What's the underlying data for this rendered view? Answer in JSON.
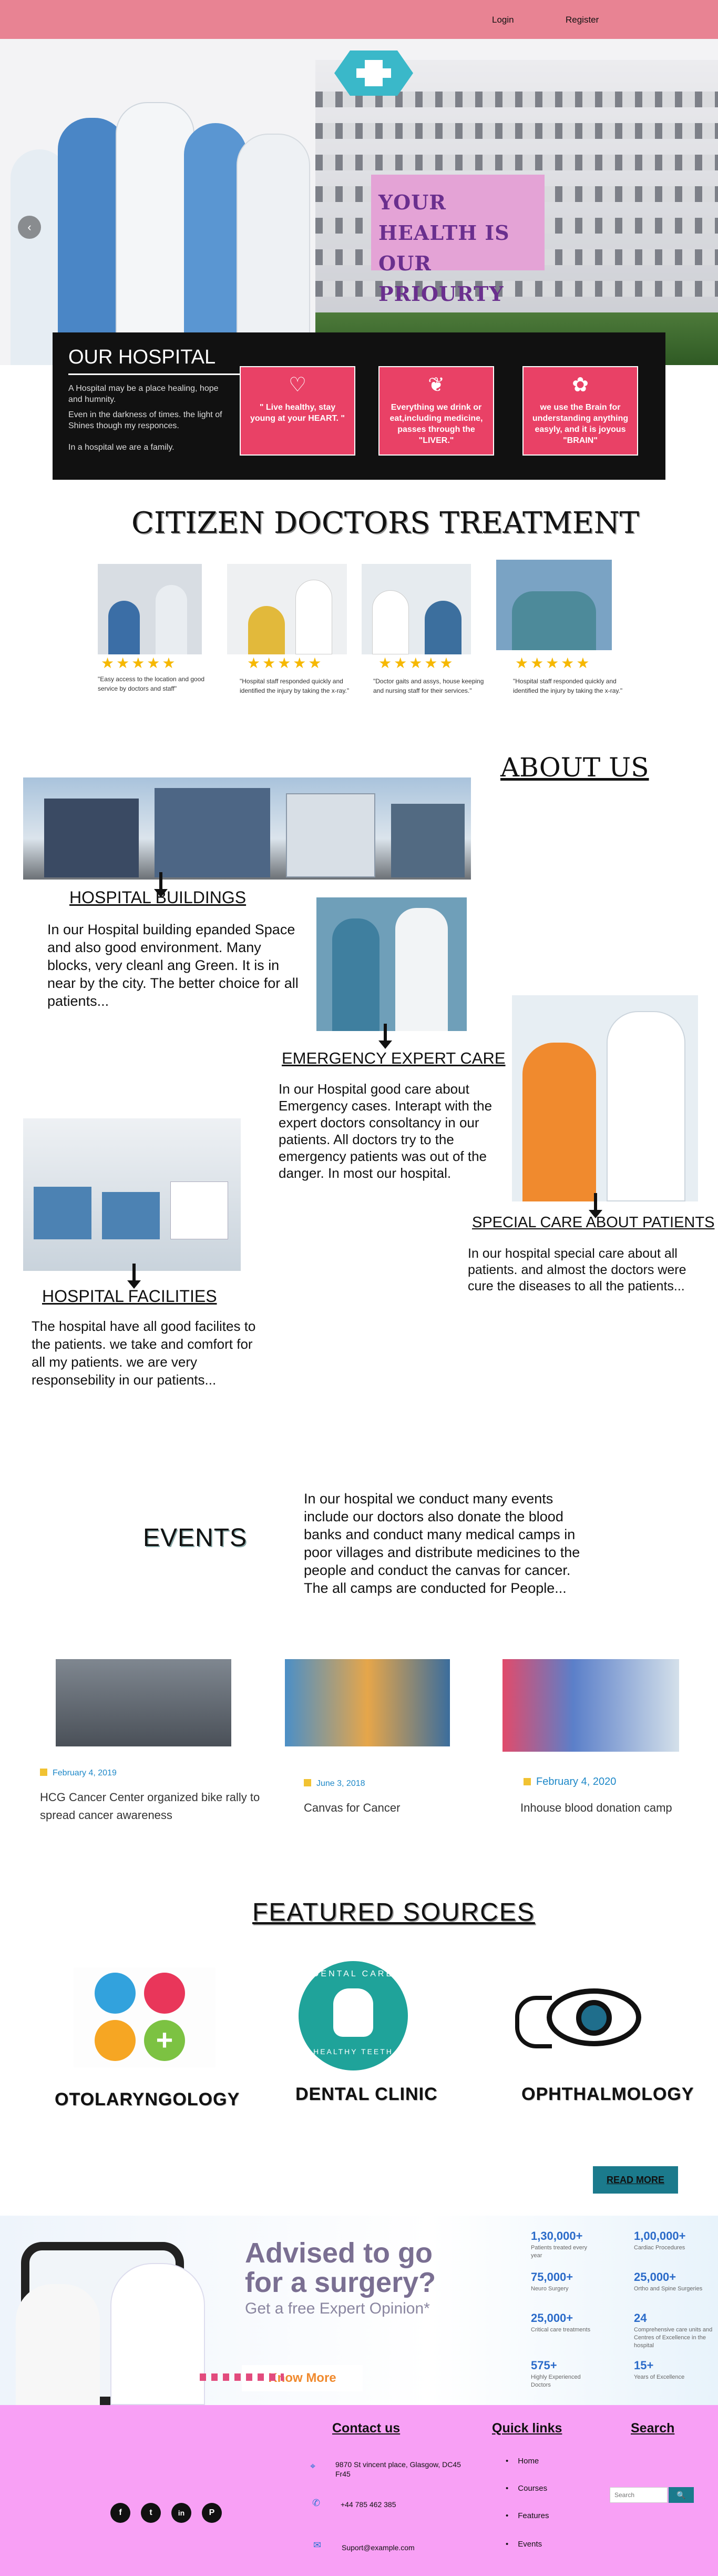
{
  "header": {
    "login": "Login",
    "register": "Register"
  },
  "hero": {
    "slogan_line1": "YOUR HEALTH IS",
    "slogan_line2": "OUR PRIOURTY",
    "prev_arrow": "‹"
  },
  "hospital_panel": {
    "title": "OUR HOSPITAL",
    "intro": "A Hospital may be a place healing, hope and humnity.",
    "line2": "Even in the darkness of times. the light of Shines though my responces.",
    "line3": "In a hospital we are a family.",
    "boxes": [
      {
        "text": "\" Live healthy, stay young at your HEART. \"",
        "icon": "heart-pulse-icon"
      },
      {
        "text": "Everything we drink or eat,including medicine, passes through the \"LIVER.\"",
        "icon": "liver-icon"
      },
      {
        "text": "we use the Brain for understanding anything easyly, and it is joyous \"BRAIN\"",
        "icon": "brain-icon"
      }
    ]
  },
  "treatment": {
    "title": "CITIZEN DOCTORS TREATMENT",
    "cards": [
      {
        "stars": "★★★★★",
        "caption": "\"Easy access to the location and good service by doctors and staff\""
      },
      {
        "stars": "★★★★★",
        "caption": "\"Hospital staff responded quickly and identified the injury by taking the x-ray.\""
      },
      {
        "stars": "★★★★★",
        "caption": "\"Doctor gaits and assys, house keeping and nursing staff for their services.\""
      },
      {
        "stars": "★★★★★",
        "caption": "\"Hospital staff responded quickly and identified the injury by taking the x-ray.\""
      }
    ]
  },
  "about": {
    "title": "ABOUT US",
    "buildings": {
      "heading": "HOSPITAL BUILDINGS",
      "text": "In our Hospital building epanded Space and also good environment. Many blocks, very cleanl ang Green. It is in near by the city. The better choice for all patients..."
    },
    "emergency": {
      "heading": "EMERGENCY EXPERT CARE",
      "text": "In our Hospital good care about Emergency cases. Interapt with the expert doctors consoltancy in our patients. All doctors try to the emergency patients was out of the danger. In most our hospital."
    },
    "special": {
      "heading": "SPECIAL CARE ABOUT PATIENTS",
      "text": "In our hospital special care about all patients. and almost the doctors were cure the diseases to all the patients..."
    },
    "facilities": {
      "heading": "HOSPITAL FACILITIES",
      "text": "The hospital have all good facilites to the patients. we take and comfort for all my patients. we are very responsebility in our patients..."
    }
  },
  "events": {
    "title": "EVENTS",
    "intro": "In our hospital we conduct many events include our doctors also donate the blood banks and conduct many medical camps in poor villages and distribute medicines to the people and conduct the canvas for cancer. The all camps are conducted for People...",
    "items": [
      {
        "date": "February 4, 2019",
        "title": "HCG Cancer Center organized bike rally to spread cancer awareness"
      },
      {
        "date": "June 3, 2018",
        "title": "Canvas for Cancer"
      },
      {
        "date": "February 4, 2020",
        "title": "Inhouse blood donation camp"
      }
    ]
  },
  "featured": {
    "title": "FEATURED SOURCES",
    "items": [
      {
        "label": "OTOLARYNGOLOGY",
        "icon": "ent-organs-icon"
      },
      {
        "label": "DENTAL CLINIC",
        "icon": "tooth-icon",
        "badge_top": "DENTAL CARE",
        "badge_bottom": "HEALTHY TEETH"
      },
      {
        "label": "OPHTHALMOLOGY",
        "icon": "eye-stethoscope-icon"
      }
    ],
    "read_more": "READ MORE"
  },
  "advised": {
    "headline1": "Advised to go",
    "headline2": "for a surgery?",
    "subline": "Get a free Expert Opinion*",
    "button": "Know More",
    "stats": [
      {
        "value": "1,30,000+",
        "label": "Patients treated every year"
      },
      {
        "value": "1,00,000+",
        "label": "Cardiac Procedures"
      },
      {
        "value": "75,000+",
        "label": "Neuro Surgery"
      },
      {
        "value": "25,000+",
        "label": "Ortho and Spine Surgeries"
      },
      {
        "value": "25,000+",
        "label": "Critical care treatments"
      },
      {
        "value": "24",
        "label": "Comprehensive care units and Centres of Excellence in the hospital"
      },
      {
        "value": "575+",
        "label": "Highly Experienced Doctors"
      },
      {
        "value": "15+",
        "label": "Years of Excellence"
      }
    ]
  },
  "footer": {
    "contact": {
      "heading": "Contact us",
      "address": "9870 St vincent place, Glasgow, DC45 Fr45",
      "phone": "+44 785 462 385",
      "email": "Suport@example.com"
    },
    "quick_links": {
      "heading": "Quick links",
      "items": [
        "Home",
        "Courses",
        "Features",
        "Events"
      ]
    },
    "search": {
      "heading": "Search",
      "placeholder": "Search",
      "button": "🔍"
    },
    "social": [
      "f",
      "t",
      "in",
      "P"
    ]
  },
  "colors": {
    "topbar": "#e88393",
    "box": "#e94166",
    "footer": "#f8a0f5",
    "panel": "#111111",
    "read_more": "#1b7a8c"
  }
}
